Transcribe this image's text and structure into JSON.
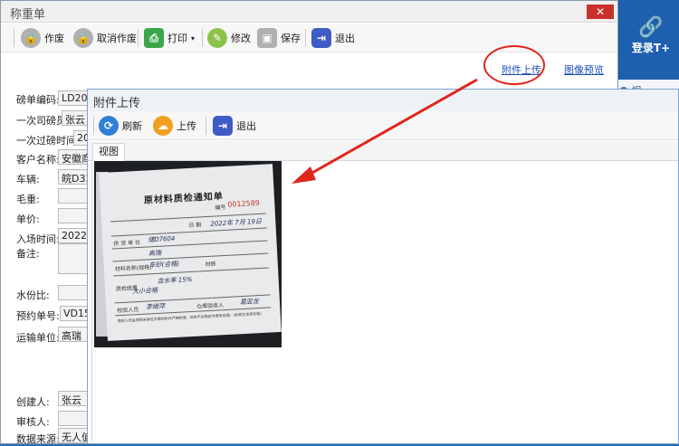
{
  "background_app": {
    "login_label": "登录T+",
    "side_item": "视"
  },
  "window": {
    "title": "称重单",
    "close_label": "✕"
  },
  "toolbar": [
    {
      "label": "作废",
      "icon": "lock-icon",
      "color": "#b0b0b0"
    },
    {
      "label": "取消作废",
      "icon": "unlock-icon",
      "color": "#b0b0b0"
    },
    {
      "label": "打印",
      "icon": "printer-icon",
      "color": "#3aa64a"
    },
    {
      "label": "修改",
      "icon": "pencil-icon",
      "color": "#8bc34a"
    },
    {
      "label": "保存",
      "icon": "save-icon",
      "color": "#b0b0b0"
    },
    {
      "label": "退出",
      "icon": "exit-icon",
      "color": "#3f5bc6"
    }
  ],
  "links": {
    "attachment_upload": "附件上传",
    "image_preview": "图像预览"
  },
  "form": {
    "bill_no": {
      "label": "磅单编码:",
      "value": "LD202"
    },
    "driver": {
      "label": "一次司磅员",
      "value": "张云"
    },
    "first_time": {
      "label": "一次过磅时间:",
      "value": "20"
    },
    "customer": {
      "label": "客户名称:",
      "value": "安徽商"
    },
    "vehicle": {
      "label": "车辆:",
      "value": "皖D32"
    },
    "gross": {
      "label": "毛重:",
      "value": ""
    },
    "unit_price": {
      "label": "单价:",
      "value": ""
    },
    "entry_time": {
      "label": "入场时间:",
      "value": "2022/"
    },
    "remark": {
      "label": "备注:",
      "value": ""
    },
    "moisture": {
      "label": "水份比:",
      "value": ""
    },
    "reservation": {
      "label": "预约单号:",
      "value": "VD154"
    },
    "transport": {
      "label": "运输单位:",
      "value": "高瑞"
    },
    "creator": {
      "label": "创建人:",
      "value": "张云"
    },
    "auditor": {
      "label": "审核人:",
      "value": ""
    },
    "data_source": {
      "label": "数据来源:",
      "value": "无人值"
    }
  },
  "dialog": {
    "title": "附件上传",
    "toolbar": [
      {
        "label": "刷新",
        "icon": "refresh-icon",
        "color": "#2f7fd6"
      },
      {
        "label": "上传",
        "icon": "upload-cloud-icon",
        "color": "#f0a020"
      },
      {
        "label": "退出",
        "icon": "exit-icon",
        "color": "#3f5bc6"
      }
    ],
    "tab": "视图"
  },
  "photo": {
    "title": "原材料质检通知单",
    "serial": "0012589",
    "number_label": "编号",
    "date_label": "日 期",
    "date_value": "2022年 7月 19日",
    "row_labels": [
      "供 货 单 位",
      "材料名称(规格)",
      "质检结果",
      "检验人员",
      "质检员签字"
    ],
    "handwriting": [
      "储D7604",
      "高瑞",
      "车砂(合格)",
      "含水率 15%",
      "大小合格",
      "李继萍",
      "葛亚龙"
    ],
    "check_label": "材质",
    "receiver_label": "仓库验收人",
    "footer": "质检人员会同相关单位对原材料作严格检查，如有不合格应作退货处理。(此联交仓库存档)"
  },
  "annotation_color": "#e0261b"
}
